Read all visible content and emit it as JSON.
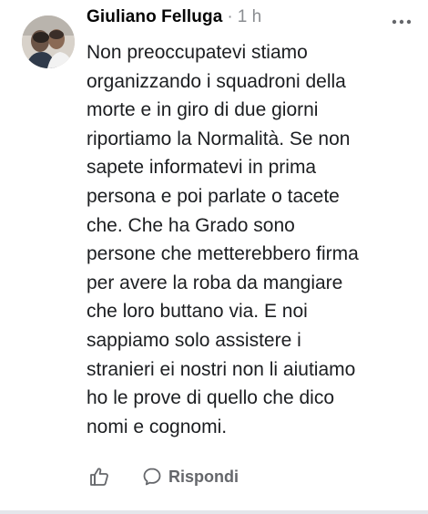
{
  "comment": {
    "author": "Giuliano Felluga",
    "separator": "·",
    "time": "1 h",
    "body_lines": [
      "Non preoccupatevi stiamo",
      "organizzando i squadroni della",
      "morte e in giro di due giorni",
      "riportiamo la Normalità. Se non",
      "sapete informatevi in prima",
      "persona e poi parlate o tacete",
      "che. Che ha Grado sono",
      "persone che metterebbero firma",
      "per avere la roba da mangiare",
      "che loro buttano via. E noi",
      "sappiamo solo assistere i",
      "stranieri ei nostri non li aiutiamo",
      "ho le prove di quello che dico",
      "nomi e cognomi."
    ]
  },
  "actions": {
    "like_icon": "thumbs-up-icon",
    "reply_icon": "speech-bubble-icon",
    "reply_label": "Rispondi"
  },
  "menu": {
    "icon": "more-horizontal-icon"
  },
  "colors": {
    "author": "#050505",
    "meta": "#8a8d91",
    "text": "#1c1e21",
    "action": "#65676b"
  }
}
